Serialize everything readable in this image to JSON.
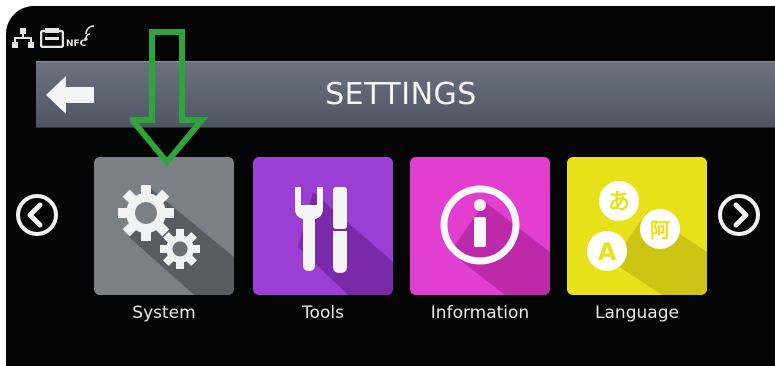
{
  "header": {
    "title": "SETTINGS"
  },
  "status_bar": {
    "icons": [
      "network-icon",
      "card-reader-icon",
      "nfc-icon"
    ],
    "nfc_label": "NFC"
  },
  "menu": {
    "items": [
      {
        "label": "System",
        "icon": "gears-icon",
        "color": "#7b7f86"
      },
      {
        "label": "Tools",
        "icon": "tools-icon",
        "color": "#9b3fd4"
      },
      {
        "label": "Information",
        "icon": "info-icon",
        "color": "#e23fd0"
      },
      {
        "label": "Language",
        "icon": "language-icon",
        "color": "#e9e21a"
      }
    ],
    "language_glyphs": {
      "top": "あ",
      "left": "A",
      "right": "阿"
    }
  },
  "colors": {
    "title_bar": "#5f6673",
    "annotation_arrow": "#2fa43a",
    "screen_background": "#050505"
  }
}
